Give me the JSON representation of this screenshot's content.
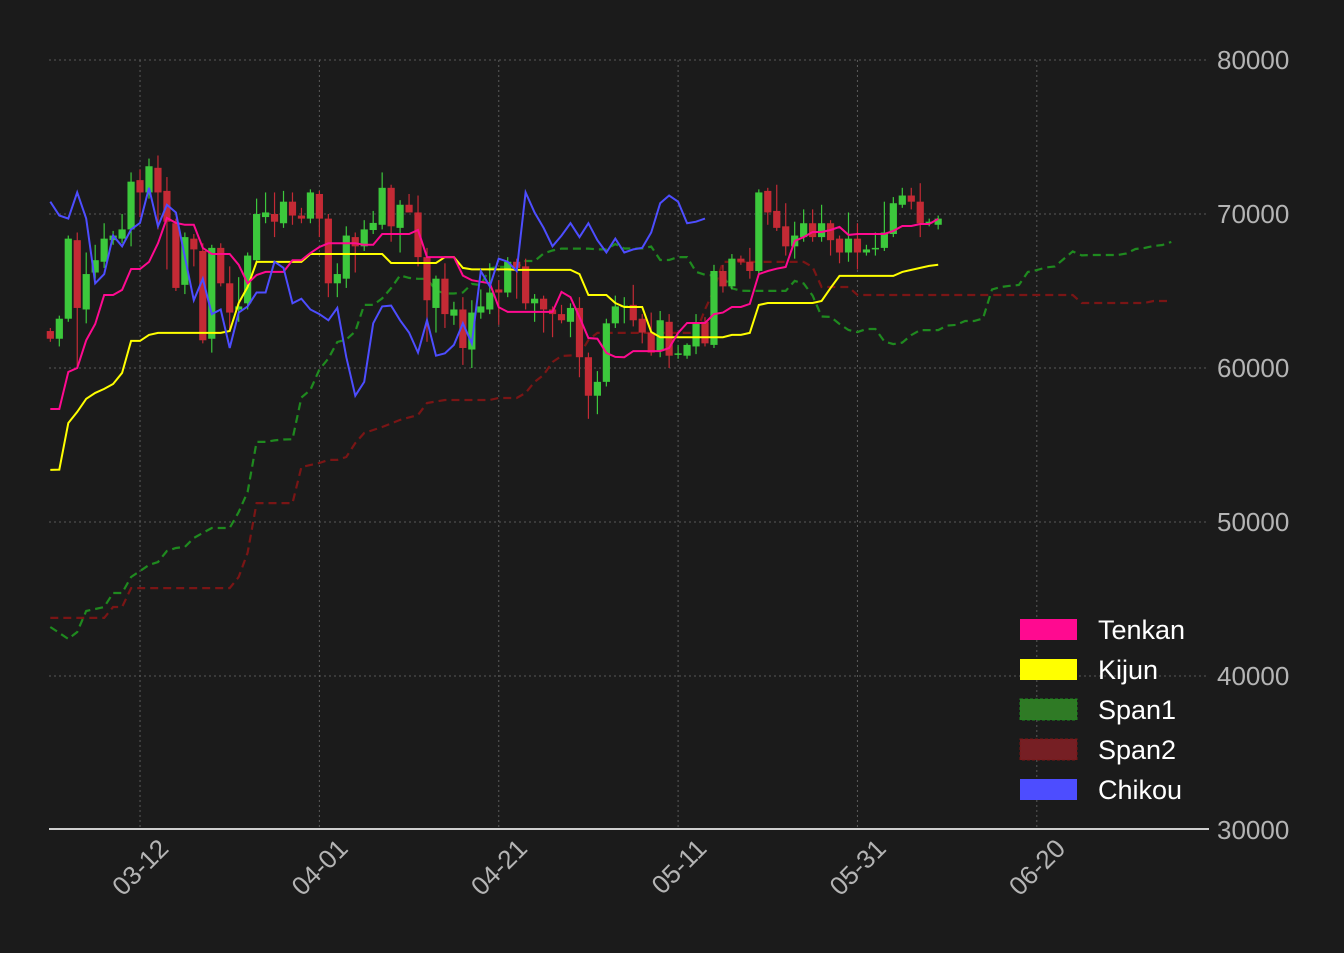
{
  "chart_data": {
    "type": "candlestick-ichimoku",
    "title": "",
    "xlabel": "",
    "ylabel": "",
    "ylim": [
      30000,
      80000
    ],
    "xlim_days": [
      -0.15,
      129.2
    ],
    "grid": true,
    "legend_position": "bottom-right",
    "y_ticks": [
      "30000",
      "40000",
      "50000",
      "60000",
      "70000",
      "80000"
    ],
    "y_tick_values": [
      30000,
      40000,
      50000,
      60000,
      70000,
      80000
    ],
    "x_ticks": [
      {
        "day": 10,
        "label": "03-12"
      },
      {
        "day": 30,
        "label": "04-01"
      },
      {
        "day": 50,
        "label": "04-21"
      },
      {
        "day": 70,
        "label": "05-11"
      },
      {
        "day": 90,
        "label": "05-31"
      },
      {
        "day": 110,
        "label": "06-20"
      }
    ],
    "colors": {
      "background": "#1b1b1b",
      "up": "#3cc83c",
      "down": "#c42a35",
      "tenkan": "#ff0a90",
      "kijun": "#ffff00",
      "span1": "#1f8a1f",
      "span2": "#7a1515",
      "chikou": "#4d4dff",
      "span1_legend": "#2f7a25",
      "span2_legend": "#761f24"
    },
    "legend": [
      {
        "key": "tenkan",
        "label": "Tenkan"
      },
      {
        "key": "kijun",
        "label": "Kijun"
      },
      {
        "key": "span1",
        "label": "Span1"
      },
      {
        "key": "span2",
        "label": "Span2"
      },
      {
        "key": "chikou",
        "label": "Chikou"
      }
    ],
    "candles_ohlc": [
      [
        62400,
        62600,
        61700,
        61900
      ],
      [
        61900,
        63400,
        61400,
        63200
      ],
      [
        63200,
        68600,
        63000,
        68400
      ],
      [
        68300,
        68800,
        60000,
        63900
      ],
      [
        63800,
        67500,
        62900,
        66100
      ],
      [
        66200,
        68000,
        65800,
        67000
      ],
      [
        66900,
        69400,
        66500,
        68400
      ],
      [
        68300,
        68900,
        68000,
        68600
      ],
      [
        68400,
        70000,
        68100,
        69000
      ],
      [
        69000,
        72700,
        67900,
        72100
      ],
      [
        72200,
        72900,
        69800,
        71400
      ],
      [
        71400,
        73600,
        71000,
        73100
      ],
      [
        73000,
        73800,
        69000,
        71400
      ],
      [
        71500,
        72400,
        66400,
        69500
      ],
      [
        69400,
        69700,
        65000,
        65200
      ],
      [
        65400,
        68800,
        64800,
        68500
      ],
      [
        68400,
        68700,
        66600,
        67700
      ],
      [
        67600,
        68100,
        61600,
        61800
      ],
      [
        61900,
        68000,
        61000,
        67800
      ],
      [
        67800,
        68100,
        65300,
        65500
      ],
      [
        65500,
        66600,
        62500,
        63600
      ],
      [
        63800,
        65900,
        63000,
        64000
      ],
      [
        64200,
        67500,
        63800,
        67300
      ],
      [
        67000,
        71000,
        66800,
        70000
      ],
      [
        69800,
        71400,
        69400,
        70100
      ],
      [
        70000,
        71400,
        68500,
        69500
      ],
      [
        69400,
        71500,
        69100,
        70800
      ],
      [
        70800,
        71400,
        69300,
        69900
      ],
      [
        69900,
        70400,
        69400,
        69700
      ],
      [
        69700,
        71600,
        69400,
        71400
      ],
      [
        71300,
        71500,
        68500,
        69700
      ],
      [
        69700,
        70000,
        64600,
        65500
      ],
      [
        65500,
        66800,
        64600,
        66100
      ],
      [
        65800,
        69200,
        65200,
        68600
      ],
      [
        68500,
        68800,
        66200,
        67900
      ],
      [
        67900,
        69600,
        67600,
        69000
      ],
      [
        68960,
        70200,
        68700,
        69420
      ],
      [
        69300,
        72700,
        69000,
        71700
      ],
      [
        71700,
        71900,
        68200,
        69200
      ],
      [
        69100,
        70900,
        67500,
        70600
      ],
      [
        70600,
        71300,
        70300,
        70100
      ],
      [
        70100,
        71200,
        66600,
        67200
      ],
      [
        67200,
        67800,
        61700,
        64400
      ],
      [
        63900,
        66000,
        62300,
        65800
      ],
      [
        65800,
        66800,
        62600,
        63500
      ],
      [
        63400,
        64300,
        62800,
        63800
      ],
      [
        63800,
        64600,
        60200,
        61300
      ],
      [
        61200,
        64400,
        60000,
        63600
      ],
      [
        63600,
        65100,
        63200,
        64000
      ],
      [
        63800,
        66800,
        63500,
        64900
      ],
      [
        65100,
        65700,
        62800,
        64900
      ],
      [
        64900,
        67200,
        64600,
        66900
      ],
      [
        66900,
        67100,
        64500,
        66500
      ],
      [
        66600,
        67100,
        63800,
        64200
      ],
      [
        64200,
        64800,
        63000,
        64500
      ],
      [
        64500,
        64700,
        62300,
        63800
      ],
      [
        63800,
        64000,
        62000,
        63500
      ],
      [
        63500,
        64100,
        62900,
        63100
      ],
      [
        63000,
        64200,
        62000,
        63900
      ],
      [
        63900,
        64600,
        59400,
        60700
      ],
      [
        60700,
        61000,
        56700,
        58200
      ],
      [
        58200,
        59800,
        57000,
        59100
      ],
      [
        59100,
        63200,
        58800,
        62900
      ],
      [
        62900,
        64700,
        62600,
        64000
      ],
      [
        64000,
        64600,
        62900,
        64050
      ],
      [
        64100,
        65400,
        62700,
        63100
      ],
      [
        63200,
        63500,
        61600,
        62300
      ],
      [
        62300,
        63600,
        60800,
        61000
      ],
      [
        61100,
        63700,
        60700,
        63100
      ],
      [
        63000,
        63500,
        60000,
        60800
      ],
      [
        60900,
        61500,
        60600,
        60950
      ],
      [
        60800,
        61600,
        60600,
        61500
      ],
      [
        61400,
        63500,
        60900,
        62900
      ],
      [
        63000,
        63300,
        61400,
        61600
      ],
      [
        61500,
        66700,
        61300,
        66300
      ],
      [
        66300,
        66700,
        64900,
        65300
      ],
      [
        65300,
        67400,
        65100,
        67100
      ],
      [
        67100,
        67300,
        66700,
        66900
      ],
      [
        66900,
        67800,
        65800,
        66300
      ],
      [
        66300,
        71600,
        66100,
        71400
      ],
      [
        71500,
        71700,
        69300,
        70100
      ],
      [
        70200,
        71900,
        68900,
        69100
      ],
      [
        69200,
        70700,
        67300,
        67900
      ],
      [
        67900,
        69500,
        67100,
        68600
      ],
      [
        68500,
        70300,
        68200,
        69400
      ],
      [
        69400,
        70300,
        68200,
        68500
      ],
      [
        68500,
        70600,
        68200,
        69400
      ],
      [
        69400,
        69600,
        67300,
        68300
      ],
      [
        68400,
        68600,
        66800,
        67500
      ],
      [
        67500,
        70100,
        66900,
        68400
      ],
      [
        68400,
        69400,
        66400,
        67500
      ],
      [
        67500,
        68000,
        67300,
        67700
      ],
      [
        67700,
        68800,
        67300,
        67800
      ],
      [
        67800,
        70800,
        67600,
        68800
      ],
      [
        68700,
        71100,
        68500,
        70700
      ],
      [
        70600,
        71700,
        70400,
        71200
      ],
      [
        71200,
        71700,
        70300,
        70800
      ],
      [
        70800,
        72000,
        68500,
        69400
      ],
      [
        69400,
        69700,
        69200,
        69500
      ],
      [
        69300,
        69900,
        69000,
        69700
      ]
    ],
    "tenkan": [
      57340,
      57340,
      59740,
      60000,
      61800,
      62860,
      64740,
      64740,
      65070,
      66430,
      66430,
      66890,
      68100,
      69740,
      69420,
      69300,
      69300,
      67800,
      67400,
      67400,
      67400,
      66700,
      65500,
      66040,
      66240,
      66240,
      66240,
      67000,
      67000,
      67470,
      67860,
      68100,
      68100,
      68100,
      68100,
      68000,
      68000,
      68700,
      68700,
      68700,
      68700,
      68960,
      67200,
      67200,
      67200,
      67200,
      66000,
      65700,
      65600,
      65500,
      63950,
      63640,
      63640,
      63640,
      63640,
      63640,
      63640,
      64940,
      64600,
      63300,
      61950,
      61900,
      60980,
      60720,
      60700,
      61100,
      61100,
      61100,
      61100,
      61300,
      62270,
      62920,
      62920,
      62920,
      63500,
      63600,
      63960,
      63960,
      64160,
      66100,
      66300,
      66450,
      66560,
      68250,
      68500,
      68830,
      68830,
      68960,
      69160,
      68640,
      68700,
      68700,
      68700,
      68700,
      68900,
      69220,
      69220,
      69350,
      69350,
      69680
    ],
    "kijun": [
      53380,
      53400,
      56430,
      57150,
      58000,
      58380,
      58640,
      58960,
      59680,
      61760,
      61760,
      62150,
      62280,
      62280,
      62280,
      62280,
      62280,
      62280,
      62280,
      62280,
      62400,
      64220,
      65260,
      66890,
      66890,
      66890,
      66890,
      66890,
      66890,
      67400,
      67400,
      67400,
      67400,
      67400,
      67400,
      67400,
      67400,
      67400,
      66820,
      66820,
      66820,
      66820,
      66820,
      66820,
      67200,
      67200,
      66500,
      66400,
      66400,
      66400,
      66400,
      66400,
      66370,
      66370,
      66370,
      66370,
      66370,
      66370,
      66370,
      66100,
      64740,
      64740,
      64740,
      64220,
      63960,
      63960,
      63960,
      62340,
      62000,
      62000,
      62000,
      62000,
      62000,
      62000,
      62000,
      62000,
      62150,
      62150,
      62280,
      64090,
      64220,
      64220,
      64220,
      64220,
      64220,
      64220,
      64350,
      65200,
      65980,
      65980,
      65980,
      65980,
      65980,
      65980,
      65980,
      66240,
      66370,
      66500,
      66630,
      66700
    ],
    "span1_leading": [
      43180,
      42800,
      42400,
      42860,
      44220,
      44350,
      44480,
      45390,
      45390,
      46430,
      46820,
      47210,
      47400,
      48120,
      48310,
      48380,
      48960,
      49290,
      49610,
      49610,
      49610,
      50650,
      51950,
      55200,
      55200,
      55300
    ],
    "span1_shift_days": 26,
    "chikou_shift_days": 26,
    "span2": [
      [
        0,
        43770
      ],
      [
        6,
        43770
      ],
      [
        7,
        44480
      ],
      [
        8,
        44480
      ],
      [
        9,
        45710
      ],
      [
        20,
        45710
      ],
      [
        21,
        46430
      ],
      [
        22,
        48000
      ],
      [
        23,
        51230
      ],
      [
        27,
        51230
      ],
      [
        28,
        53570
      ],
      [
        30,
        53830
      ],
      [
        31,
        54030
      ],
      [
        32,
        54030
      ],
      [
        33,
        54220
      ],
      [
        34,
        55130
      ],
      [
        35,
        55780
      ],
      [
        37,
        56170
      ],
      [
        39,
        56630
      ],
      [
        41,
        56950
      ],
      [
        42,
        57730
      ],
      [
        44,
        57920
      ],
      [
        49,
        57920
      ],
      [
        50,
        58050
      ],
      [
        52,
        58050
      ],
      [
        53,
        58380
      ],
      [
        54,
        59100
      ],
      [
        55,
        59550
      ],
      [
        56,
        60390
      ],
      [
        57,
        60780
      ],
      [
        59,
        60850
      ],
      [
        60,
        61820
      ],
      [
        61,
        62280
      ],
      [
        72,
        62280
      ],
      [
        73,
        63800
      ],
      [
        74,
        65070
      ],
      [
        75,
        66890
      ],
      [
        84,
        66890
      ],
      [
        85,
        66560
      ],
      [
        86,
        65260
      ],
      [
        89,
        65260
      ],
      [
        90,
        64740
      ],
      [
        114,
        64740
      ],
      [
        115,
        64220
      ],
      [
        122,
        64220
      ],
      [
        123,
        64350
      ],
      [
        125,
        64350
      ]
    ]
  }
}
